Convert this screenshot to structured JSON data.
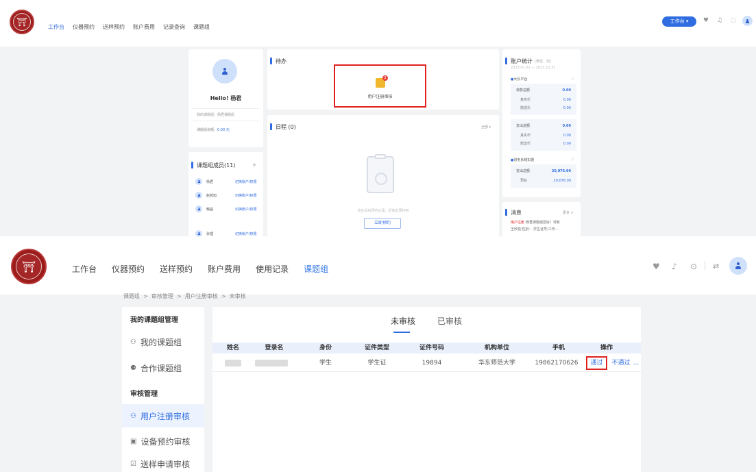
{
  "top": {
    "nav": [
      "工作台",
      "仪器预约",
      "送样预约",
      "账户费用",
      "记录查询",
      "课题组"
    ],
    "workspace_btn": "工作台 ▾",
    "profile": {
      "greeting": "Hello! 杨君",
      "group_label": "我的课题组：",
      "group_value": "杨君课题组",
      "balance_label": "课题组余额：",
      "balance_value": "0.00 元"
    },
    "todo": {
      "title": "待办",
      "item": "用户注册审核",
      "badge": "2"
    },
    "schedule": {
      "title": "日程 (0)",
      "filter": "全部 ▾",
      "empty_text": "您还没有预约记录，赶快去预约吧",
      "book_btn": "立即预约"
    },
    "members": {
      "title": "课题组成员(11)",
      "list": [
        {
          "name": "杨君",
          "action": "切换账户/权限"
        },
        {
          "name": "赵若旭",
          "action": "切换账户/权限"
        },
        {
          "name": "韩晶",
          "action": "切换账户/权限"
        },
        {
          "name": "张理",
          "action": "切换账户/权限"
        }
      ]
    },
    "account": {
      "title": "账户统计",
      "unit": "(单位：元)",
      "range": "2023.01.01 — 2023.12.31",
      "platform": "大仪平台",
      "deposit": {
        "label": "存款总额",
        "value": "0.00",
        "sub": [
          {
            "label": "真实币",
            "value": "0.00"
          },
          {
            "label": "赠送币",
            "value": "0.00"
          }
        ]
      },
      "expense": {
        "label": "支出总额",
        "value": "0.00",
        "sub": [
          {
            "label": "真实币",
            "value": "0.00"
          },
          {
            "label": "赠送币",
            "value": "0.00"
          }
        ]
      },
      "finance": "财务系统扣费",
      "finance_total": {
        "label": "支出总额",
        "value": "20,076.00"
      },
      "finance_sub": {
        "label": "预扣",
        "value": "20,076.00"
      }
    },
    "messages": {
      "title": "消息",
      "more": "更多 >",
      "line1_tag": "用户注册",
      "line1_text": "杨君课题组您好！现有",
      "line2": "王欣悦,性别：,学生证号/工作..."
    }
  },
  "bottom": {
    "nav": [
      "工作台",
      "仪器预约",
      "送样预约",
      "账户费用",
      "使用记录",
      "课题组"
    ],
    "breadcrumb": "课题组  >  审核管理  >  用户注册审核  >  未审核",
    "sidebar": {
      "group_title": "我的课题组管理",
      "my_group": "我的课题组",
      "coop_group": "合作课题组",
      "review_title": "审核管理",
      "user_review": "用户注册审核",
      "equip_review": "设备预约审核",
      "sample_review": "送样申请审核"
    },
    "tabs": [
      "未审核",
      "已审核"
    ],
    "table": {
      "headers": [
        "姓名",
        "登录名",
        "身份",
        "证件类型",
        "证件号码",
        "机构单位",
        "手机",
        "操作"
      ],
      "row": {
        "identity": "学生",
        "id_type": "学生证",
        "id_no": "19894",
        "org": "华东师范大学",
        "phone": "19862170626",
        "pass": "通过",
        "reject": "不通过",
        "more": "..."
      }
    }
  },
  "colors": {
    "accent": "#2f6de1",
    "highlight": "#e02020",
    "bg": "#f2f3f5"
  }
}
